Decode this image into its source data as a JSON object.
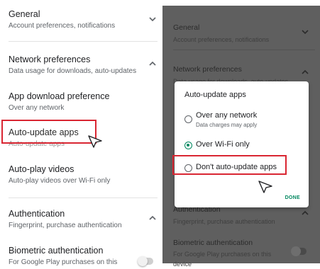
{
  "left": {
    "items": [
      {
        "title": "General",
        "subtitle": "Account preferences, notifications"
      },
      {
        "title": "Network preferences",
        "subtitle": "Data usage for downloads, auto-updates"
      },
      {
        "title": "App download preference",
        "subtitle": "Over any network"
      },
      {
        "title": "Auto-update apps",
        "subtitle": "Auto-update apps"
      },
      {
        "title": "Auto-play videos",
        "subtitle": "Auto-play videos over Wi-Fi only"
      },
      {
        "title": "Authentication",
        "subtitle": "Fingerprint, purchase authentication"
      },
      {
        "title": "Biometric authentication",
        "subtitle": "For Google Play purchases on this"
      }
    ]
  },
  "right": {
    "items": [
      {
        "title": "General",
        "subtitle": "Account preferences, notifications"
      },
      {
        "title": "Network preferences",
        "subtitle": "Data usage for downloads, auto-updates"
      },
      {
        "title": "Authentication",
        "subtitle": "Fingerprint, purchase authentication"
      },
      {
        "title": "Biometric authentication",
        "subtitle": "For Google Play purchases on this",
        "subtitle2": "device"
      }
    ],
    "dialog": {
      "title": "Auto-update apps",
      "options": [
        {
          "label": "Over any network",
          "sub": "Data charges may apply",
          "selected": false
        },
        {
          "label": "Over Wi-Fi only",
          "selected": true
        },
        {
          "label": "Don't auto-update apps",
          "selected": false
        }
      ],
      "done_label": "DONE"
    }
  },
  "colors": {
    "accent": "#01875f",
    "highlight": "#d92632",
    "scrim": "#5f5f5f"
  },
  "icons": {
    "expand": "chevron-down-icon",
    "collapse": "chevron-up-icon",
    "pointer": "cursor-arrow-icon"
  }
}
